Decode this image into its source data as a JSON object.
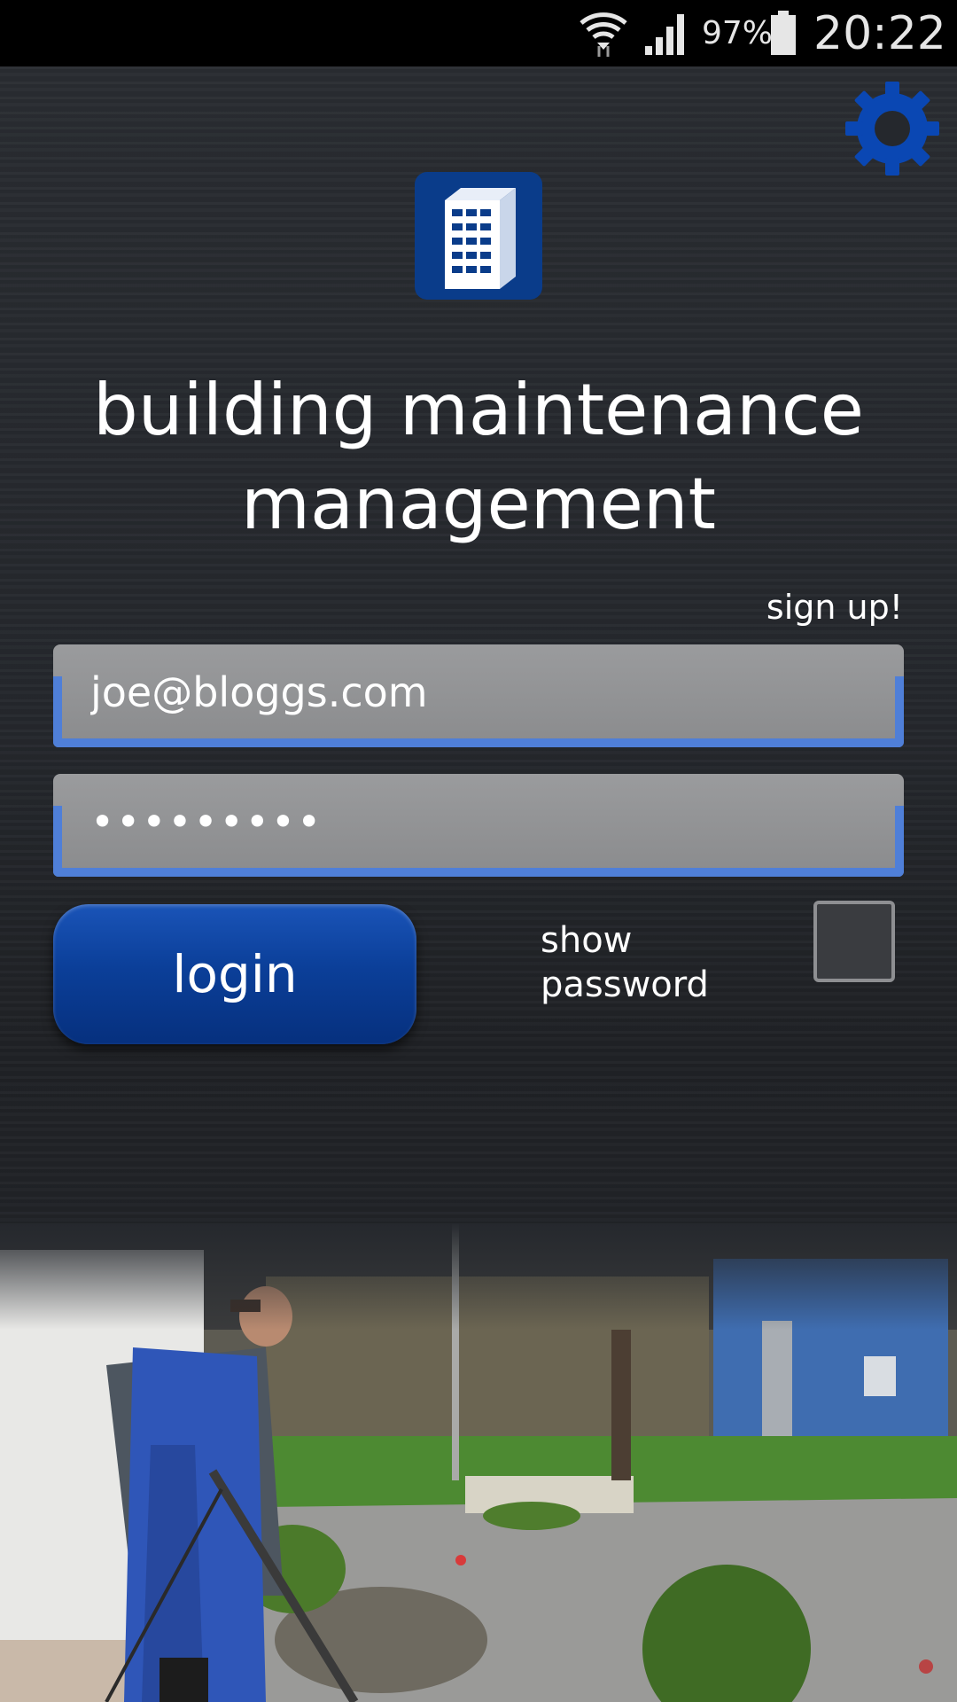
{
  "status_bar": {
    "battery_percent": "97%",
    "time": "20:22",
    "icons": [
      "wifi-icon",
      "signal-icon",
      "battery-icon"
    ]
  },
  "app": {
    "title": "building maintenance management",
    "logo_icon": "building-icon",
    "settings_icon": "gear-icon"
  },
  "form": {
    "signup_label": "sign up!",
    "email_value": "joe@bloggs.com",
    "password_value": "•••••••••",
    "login_label": "login",
    "show_password_label": "show password",
    "show_password_checked": false
  },
  "colors": {
    "accent": "#4f7fd8",
    "button": "#0b3f99",
    "logo_bg": "#0a3c8a",
    "gear": "#0a47b3",
    "background": "#25282d"
  }
}
